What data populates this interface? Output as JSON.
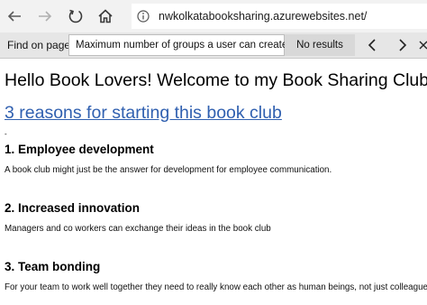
{
  "browser": {
    "url": "nwkolkatabooksharing.azurewebsites.net/"
  },
  "findbar": {
    "label": "Find on page",
    "query": "Maximum number of groups a user can create",
    "status": "No results"
  },
  "page": {
    "heading": "Hello Book Lovers! Welcome to my Book Sharing Club",
    "link": "3 reasons for starting this book club",
    "dash": "-",
    "sections": [
      {
        "title": "1. Employee development",
        "text": "A book club might just be the answer for development for employee communication."
      },
      {
        "title": "2. Increased innovation",
        "text": "Managers and co workers can exchange their ideas in the book club"
      },
      {
        "title": "3. Team bonding",
        "text": "For your team to work well together they need to really know each other as human beings, not just colleagues."
      }
    ]
  }
}
